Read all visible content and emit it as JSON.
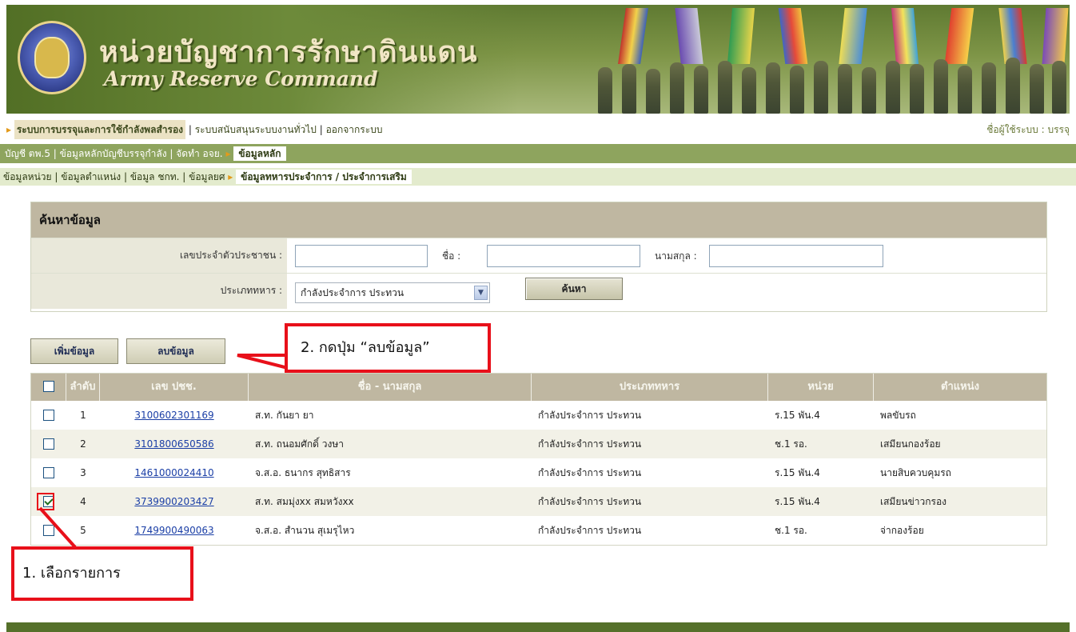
{
  "header": {
    "title_th": "หน่วยบัญชาการรักษาดินแดน",
    "title_en": "Army Reserve Command"
  },
  "nav1": {
    "selected": "ระบบการบรรจุและการใช้กำลังพลสำรอง",
    "items": [
      "ระบบสนับสนุนระบบงานทั่วไป",
      "ออกจากระบบ"
    ],
    "user_label": "ชื่อผู้ใช้ระบบ : บรรจุ"
  },
  "nav2": {
    "items": [
      "บัญชี ตพ.5",
      "ข้อมูลหลักบัญชีบรรจุกำลัง",
      "จัดทำ อจย."
    ],
    "selected": "ข้อมูลหลัก"
  },
  "nav3": {
    "items": [
      "ข้อมูลหน่วย",
      "ข้อมูลตำแหน่ง",
      "ข้อมูล ชกท.",
      "ข้อมูลยศ"
    ],
    "selected": "ข้อมูลทหารประจำการ / ประจำการเสริม"
  },
  "search": {
    "heading": "ค้นหาข้อมูล",
    "id_label": "เลขประจำตัวประชาชน :",
    "id_value": "",
    "name_label": "ชื่อ :",
    "name_value": "",
    "surname_label": "นามสกุล :",
    "surname_value": "",
    "type_label": "ประเภททหาร :",
    "type_value": "กำลังประจำการ ประทวน",
    "search_button": "ค้นหา"
  },
  "actions": {
    "add_button": "เพิ่มข้อมูล",
    "delete_button": "ลบข้อมูล"
  },
  "table": {
    "headers": [
      "ลำดับ",
      "เลข ปชช.",
      "ชื่อ - นามสกุล",
      "ประเภททหาร",
      "หน่วย",
      "ตำแหน่ง"
    ],
    "rows": [
      {
        "checked": false,
        "no": "1",
        "id": "3100602301169",
        "name": "ส.ท. กันยา ยา",
        "type": "กำลังประจำการ ประทวน",
        "unit": "ร.15 พัน.4",
        "position": "พลขับรถ"
      },
      {
        "checked": false,
        "no": "2",
        "id": "3101800650586",
        "name": "ส.ท. ถนอมศักดิ์ วงษา",
        "type": "กำลังประจำการ ประทวน",
        "unit": "ช.1 รอ.",
        "position": "เสมียนกองร้อย"
      },
      {
        "checked": false,
        "no": "3",
        "id": "1461000024410",
        "name": "จ.ส.อ. ธนากร สุทธิสาร",
        "type": "กำลังประจำการ ประทวน",
        "unit": "ร.15 พัน.4",
        "position": "นายสิบควบคุมรถ"
      },
      {
        "checked": true,
        "no": "4",
        "id": "3739900203427",
        "name": "ส.ท. สมมุ่งxx สมหวังxx",
        "type": "กำลังประจำการ ประทวน",
        "unit": "ร.15 พัน.4",
        "position": "เสมียนข่าวกรอง"
      },
      {
        "checked": false,
        "no": "5",
        "id": "1749900490063",
        "name": "จ.ส.อ. สำนวน สุเมรุไหว",
        "type": "กำลังประจำการ ประทวน",
        "unit": "ช.1 รอ.",
        "position": "จ่ากองร้อย"
      }
    ]
  },
  "annotations": {
    "step1": "1. เลือกรายการ",
    "step2": "2. กดปุ่ม “ลบข้อมูล”",
    "color": "#e8101a"
  }
}
